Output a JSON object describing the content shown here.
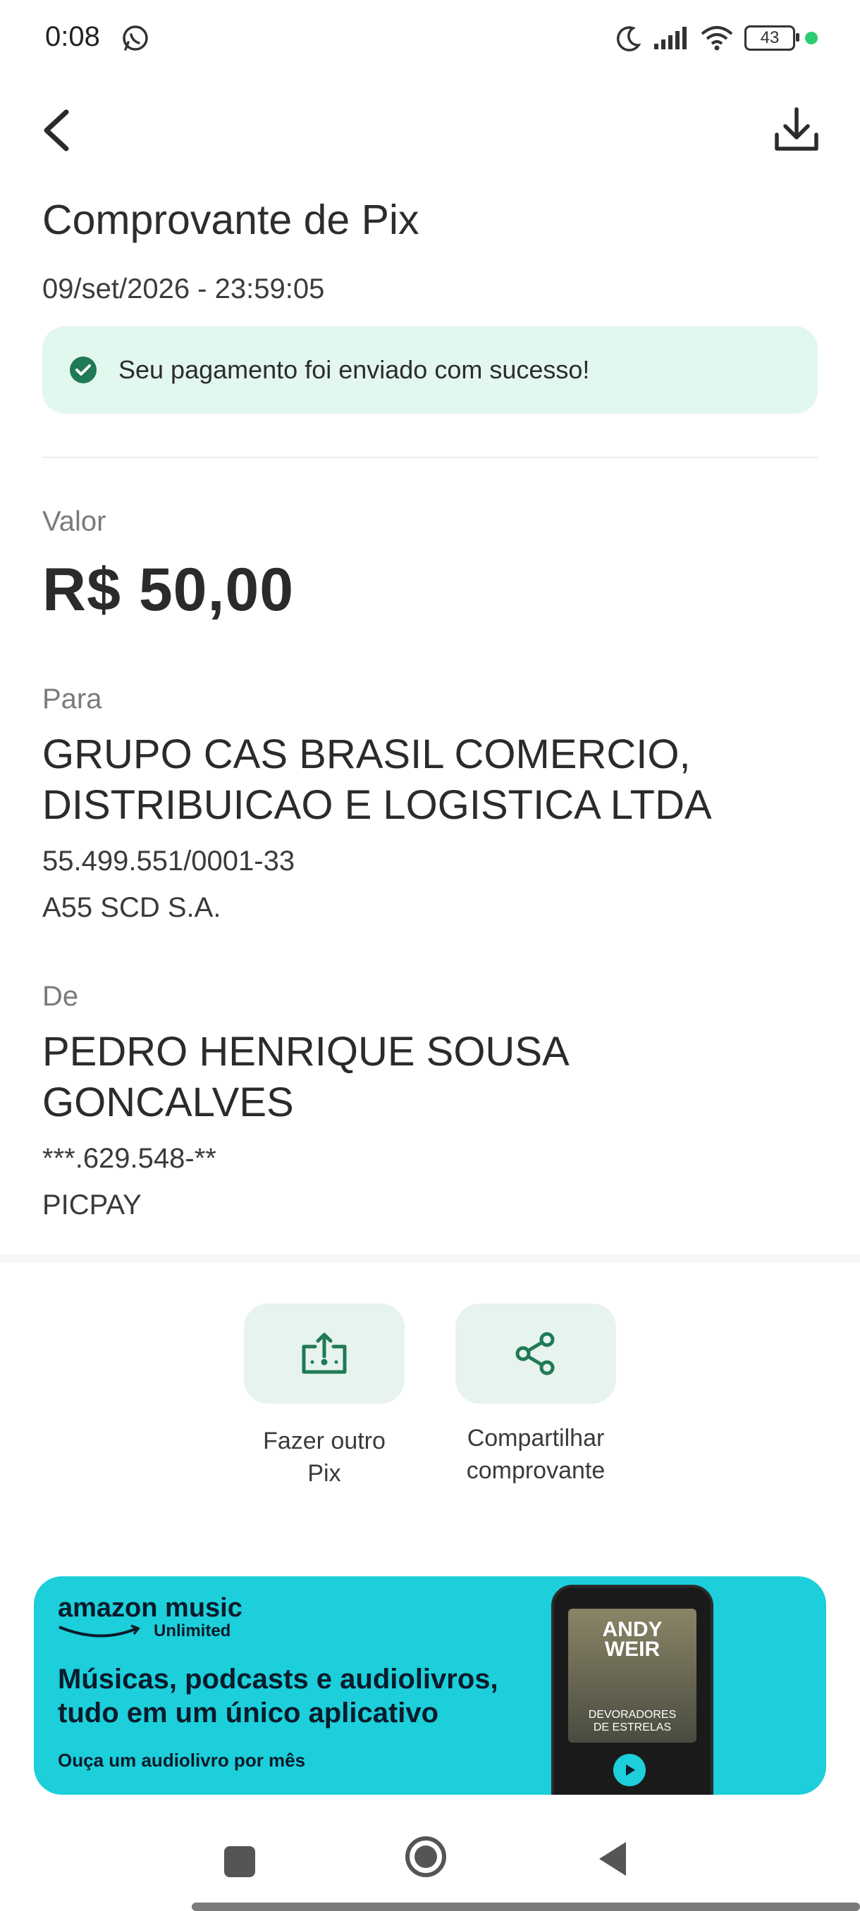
{
  "status_bar": {
    "time": "0:08",
    "battery": "43",
    "icons": [
      "whatsapp-icon",
      "moon-icon",
      "signal-icon",
      "wifi-icon",
      "battery-icon",
      "privacy-dot"
    ]
  },
  "header": {
    "back_icon": "chevron-left-icon",
    "download_icon": "download-icon"
  },
  "receipt": {
    "title": "Comprovante de Pix",
    "datetime": "09/set/2026 - 23:59:05",
    "success_message": "Seu pagamento foi enviado com sucesso!",
    "amount_label": "Valor",
    "amount": "R$ 50,00",
    "to_label": "Para",
    "to_name_line1": "GRUPO CAS BRASIL COMERCIO,",
    "to_name_line2": "DISTRIBUICAO E LOGISTICA LTDA",
    "to_document": "55.499.551/0001-33",
    "to_institution": "A55 SCD S.A.",
    "from_label": "De",
    "from_name_line1": "PEDRO HENRIQUE SOUSA",
    "from_name_line2": "GONCALVES",
    "from_document": "***.629.548-**",
    "from_institution": "PICPAY"
  },
  "actions": [
    {
      "label_line1": "Fazer outro",
      "label_line2": "Pix",
      "icon": "pix-transfer-icon"
    },
    {
      "label_line1": "Compartilhar",
      "label_line2": "comprovante",
      "icon": "share-icon"
    }
  ],
  "banner": {
    "brand_line1": "amazon music",
    "brand_line2": "Unlimited",
    "headline_line1": "Músicas, podcasts e audiolivros,",
    "headline_line2": "tudo em um único aplicativo",
    "subline": "Ouça um audiolivro por mês",
    "cover_author_line1": "ANDY",
    "cover_author_line2": "WEIR",
    "cover_title_line1": "DEVORADORES",
    "cover_title_line2": "DE ESTRELAS",
    "background_color": "#1ccfdb"
  },
  "colors": {
    "accent_green": "#1f7a55",
    "success_bg": "#e2f7ee",
    "action_bg": "#e7f3ee"
  }
}
